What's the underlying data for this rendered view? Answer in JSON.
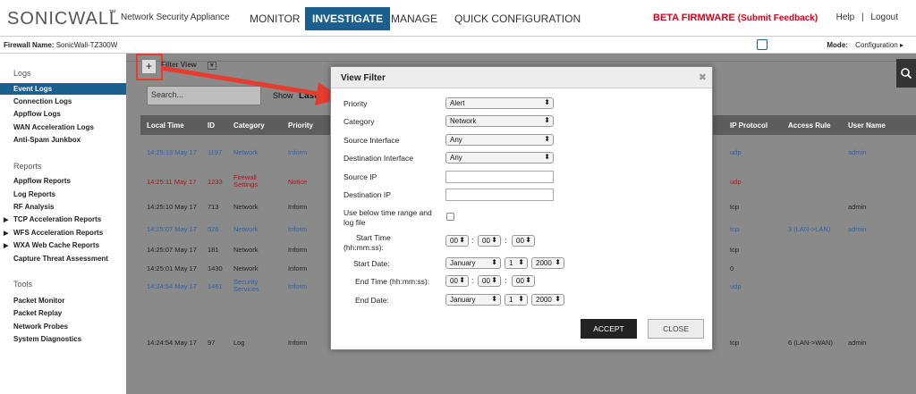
{
  "header": {
    "logo": "SONICWALL",
    "trademark": "™",
    "subtitle": "Network Security Appliance",
    "nav": [
      "MONITOR",
      "INVESTIGATE",
      "MANAGE",
      "QUICK CONFIGURATION"
    ],
    "beta": "BETA FIRMWARE",
    "feedback": "(Submit Feedback)",
    "help": "Help",
    "sep": "|",
    "logout": "Logout"
  },
  "fwbar": {
    "label": "Firewall Name:",
    "name": "SonicWall-TZ300W",
    "mode_label": "Mode:",
    "mode_value": "Configuration ▸"
  },
  "sidebar": {
    "logs_head": "Logs",
    "logs": [
      "Event Logs",
      "Connection Logs",
      "Appflow Logs",
      "WAN Acceleration Logs",
      "Anti-Spam Junkbox"
    ],
    "reports_head": "Reports",
    "reports": [
      "Appflow Reports",
      "Log Reports",
      "RF Analysis",
      "TCP Acceleration Reports",
      "WFS Acceleration Reports",
      "WXA Web Cache Reports",
      "Capture Threat Assessment"
    ],
    "tools_head": "Tools",
    "tools": [
      "Packet Monitor",
      "Packet Replay",
      "Network Probes",
      "System Diagnostics"
    ]
  },
  "main": {
    "plus": "+",
    "filter_tab": "Filter View",
    "search_placeholder": "Search...",
    "show_label": "Show",
    "last_label": "Last",
    "columns": [
      "Local Time",
      "ID",
      "Category",
      "Priority",
      "IP Protocol",
      "Access Rule",
      "User Name"
    ],
    "rows": [
      {
        "time": "14:25:13 May 17",
        "id": "1197",
        "cat": "Network",
        "pri": "Inform",
        "proto": "udp",
        "rule": "",
        "user": "admin",
        "color": "#2f5fa8"
      },
      {
        "time": "14:25:11 May 17",
        "id": "1233",
        "cat": "Firewall Settings",
        "pri": "Notice",
        "proto": "udp",
        "rule": "",
        "user": "",
        "color": "#b0141b"
      },
      {
        "time": "14:25:10 May 17",
        "id": "713",
        "cat": "Network",
        "pri": "Inform",
        "proto": "tcp",
        "rule": "",
        "user": "admin",
        "color": "#222222"
      },
      {
        "time": "14:25:07 May 17",
        "id": "526",
        "cat": "Network",
        "pri": "Inform",
        "proto": "tcp",
        "rule": "3 (LAN->LAN)",
        "user": "admin",
        "color": "#2f5fa8"
      },
      {
        "time": "14:25:07 May 17",
        "id": "181",
        "cat": "Network",
        "pri": "Inform",
        "proto": "tcp",
        "rule": "",
        "user": "",
        "color": "#222222"
      },
      {
        "time": "14:25:01 May 17",
        "id": "1430",
        "cat": "Network",
        "pri": "Inform",
        "proto": "0",
        "rule": "",
        "user": "",
        "color": "#222222"
      },
      {
        "time": "14:24:54 May 17",
        "id": "1461",
        "cat": "Security Services",
        "pri": "Inform",
        "proto": "udp",
        "rule": "",
        "user": "",
        "color": "#2f5fa8"
      },
      {
        "time": "14:24:54 May 17",
        "id": "97",
        "cat": "Log",
        "pri": "Inform",
        "proto": "tcp",
        "rule": "6 (LAN->WAN)",
        "user": "admin",
        "color": "#222222"
      }
    ]
  },
  "dialog": {
    "title": "View Filter",
    "close_icon": "✖",
    "priority_label": "Priority",
    "priority_value": "Alert",
    "category_label": "Category",
    "category_value": "Network",
    "src_if_label": "Source Interface",
    "src_if_value": "Any",
    "dst_if_label": "Destination Interface",
    "dst_if_value": "Any",
    "src_ip_label": "Source IP",
    "dst_ip_label": "Destination IP",
    "use_range_label_1": "Use below time range and",
    "use_range_label_2": "log file",
    "start_time_label_1": "Start Time",
    "start_time_label_2": "(hh:mm:ss):",
    "start_date_label": "Start Date:",
    "end_time_label": "End Time (hh:mm:ss):",
    "end_date_label": "End Date:",
    "zero": "00",
    "month": "January",
    "day": "1",
    "year": "2000",
    "accept": "ACCEPT",
    "close": "CLOSE"
  }
}
